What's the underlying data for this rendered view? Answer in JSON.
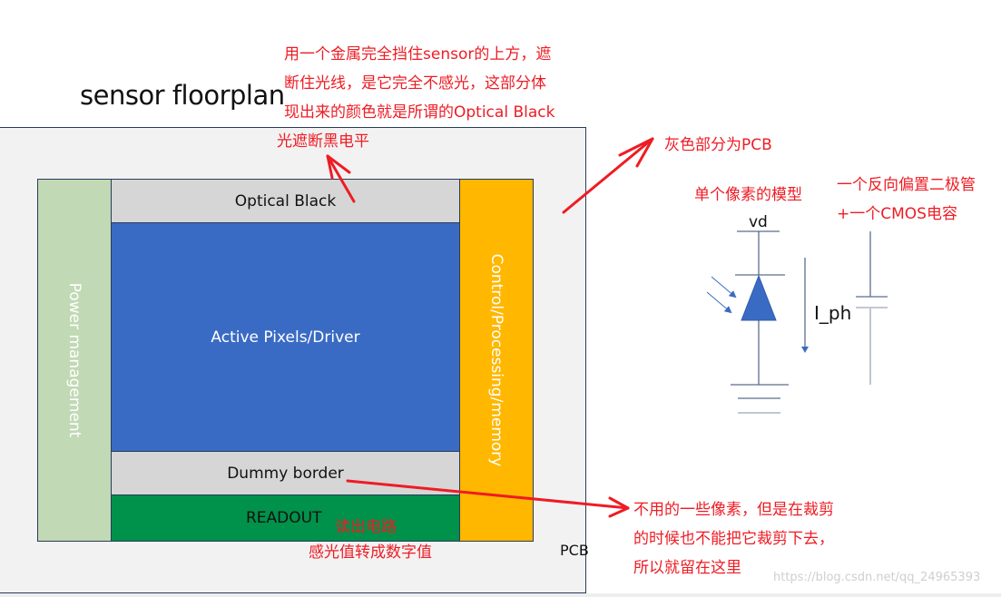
{
  "title": "sensor floorplan",
  "floorplan": {
    "power_management": "Power management",
    "optical_black": "Optical Black",
    "active_pixels": "Active Pixels/Driver",
    "dummy_border": "Dummy border",
    "readout": "READOUT",
    "control": "Control/Processing/memory",
    "pcb_label": "PCB"
  },
  "colors": {
    "pcb": "#f2f2f2",
    "power": "#c1d9b4",
    "optical_black": "#d6d6d6",
    "active": "#3a6bc4",
    "dummy": "#d6d6d6",
    "readout": "#00914a",
    "control": "#ffb700",
    "annotation": "#ee1c24"
  },
  "annotations": {
    "optical_black_note": [
      "用一个金属完全挡住sensor的上方，遮",
      "断住光线，是它完全不感光，这部分体",
      "现出来的颜色就是所谓的Optical Black",
      "光遮断黑电平"
    ],
    "pcb_note": "灰色部分为PCB",
    "pixel_model_note": "单个像素的模型",
    "diode_note": [
      "一个反向偏置二极管",
      "+一个CMOS电容"
    ],
    "readout_note_1": "读出电路",
    "readout_note_2": "感光值转成数字值",
    "dummy_note": [
      "不用的一些像素，但是在裁剪",
      "的时候也不能把它裁剪下去，",
      "所以就留在这里"
    ]
  },
  "circuit": {
    "vd_label": "vd",
    "current_label": "I_ph"
  },
  "watermark": "https://blog.csdn.net/qq_24965393"
}
